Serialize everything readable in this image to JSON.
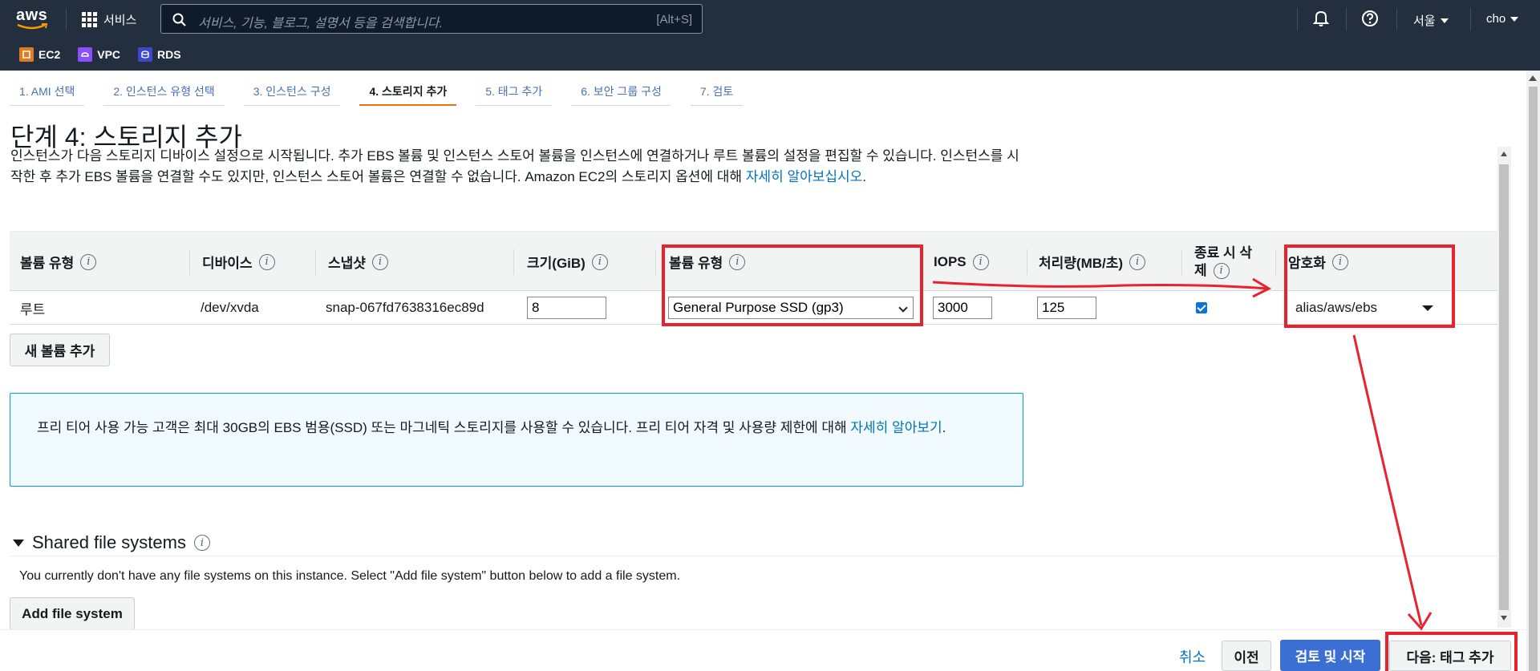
{
  "nav": {
    "logo_text": "aws",
    "services_label": "서비스",
    "search_placeholder": "서비스, 기능, 블로그, 설명서 등을 검색합니다.",
    "search_shortcut": "[Alt+S]",
    "region": "서울",
    "user": "cho",
    "favorites": [
      {
        "label": "EC2",
        "icon": "ec2-icon",
        "color": "#e07b24"
      },
      {
        "label": "VPC",
        "icon": "vpc-icon",
        "color": "#8c4fff"
      },
      {
        "label": "RDS",
        "icon": "rds-icon",
        "color": "#3b48cc"
      }
    ]
  },
  "wizard": {
    "tabs": [
      {
        "label": "1. AMI 선택",
        "active": false
      },
      {
        "label": "2. 인스턴스 유형 선택",
        "active": false
      },
      {
        "label": "3. 인스턴스 구성",
        "active": false
      },
      {
        "label": "4. 스토리지 추가",
        "active": true
      },
      {
        "label": "5. 태그 추가",
        "active": false
      },
      {
        "label": "6. 보안 그룹 구성",
        "active": false
      },
      {
        "label": "7. 검토",
        "active": false
      }
    ]
  },
  "page": {
    "title": "단계 4: 스토리지 추가",
    "description": "인스턴스가 다음 스토리지 디바이스 설정으로 시작됩니다. 추가 EBS 볼륨 및 인스턴스 스토어 볼륨을 인스턴스에 연결하거나 루트 볼륨의 설정을 편집할 수 있습니다. 인스턴스를 시작한 후 추가 EBS 볼륨을 연결할 수도 있지만, 인스턴스 스토어 볼륨은 연결할 수 없습니다. Amazon EC2의 스토리지 옵션에 대해 ",
    "learn_more": "자세히 알아보십시오",
    "period": "."
  },
  "table": {
    "headers": {
      "volume_type": "볼륨 유형",
      "device": "디바이스",
      "snapshot": "스냅샷",
      "size": "크기(GiB)",
      "volume_kind": "볼륨 유형",
      "iops": "IOPS",
      "throughput": "처리량(MB/초)",
      "delete_on_term_1": "종료 시 삭",
      "delete_on_term_2": "제",
      "encryption": "암호화"
    },
    "row": {
      "volume_type": "루트",
      "device": "/dev/xvda",
      "snapshot": "snap-067fd7638316ec89d",
      "size": "8",
      "volume_kind": "General Purpose SSD (gp3)",
      "iops": "3000",
      "throughput": "125",
      "delete_on_termination": true,
      "encryption": "alias/aws/ebs"
    },
    "add_volume_label": "새 볼륨 추가"
  },
  "info_box": {
    "text": "프리 티어 사용 가능 고객은 최대 30GB의 EBS 범용(SSD) 또는 마그네틱 스토리지를 사용할 수 있습니다. 프리 티어 자격 및 사용량 제한에 대해 ",
    "link": "자세히 알아보기",
    "period": "."
  },
  "shared_fs": {
    "title": "Shared file systems",
    "description": "You currently don't have any file systems on this instance. Select \"Add file system\" button below to add a file system.",
    "add_label": "Add file system"
  },
  "footer": {
    "cancel": "취소",
    "previous": "이전",
    "review_launch": "검토 및 시작",
    "next": "다음: 태그 추가"
  },
  "annotation": {
    "color": "#e8232f"
  }
}
